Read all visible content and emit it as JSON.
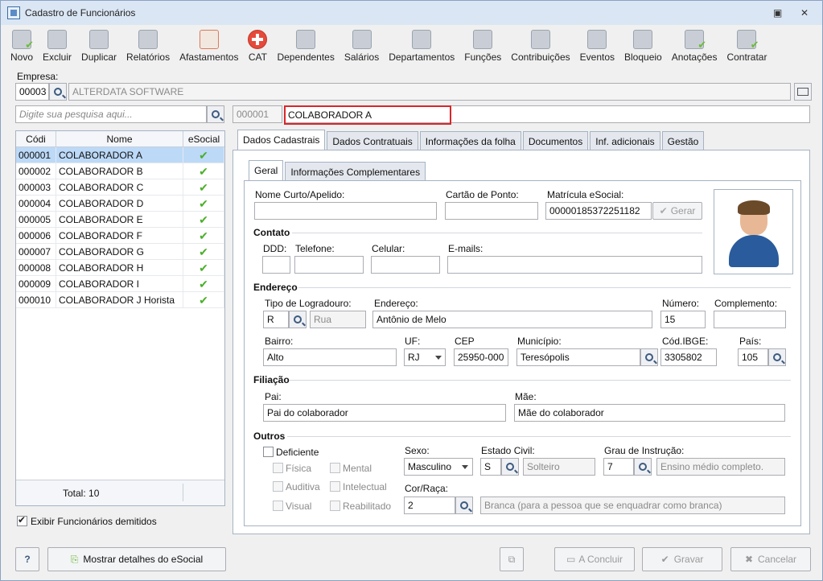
{
  "window": {
    "title": "Cadastro de Funcionários"
  },
  "toolbar": [
    {
      "label": "Novo",
      "icon": "new-icon"
    },
    {
      "label": "Excluir",
      "icon": "trash-icon"
    },
    {
      "label": "Duplicar",
      "icon": "duplicate-icon"
    },
    {
      "label": "Relatórios",
      "icon": "report-icon"
    },
    {
      "label": "Afastamentos",
      "icon": "house-icon"
    },
    {
      "label": "CAT",
      "icon": "cross-icon"
    },
    {
      "label": "Dependentes",
      "icon": "dependents-icon"
    },
    {
      "label": "Salários",
      "icon": "money-icon"
    },
    {
      "label": "Departamentos",
      "icon": "department-icon"
    },
    {
      "label": "Funções",
      "icon": "function-icon"
    },
    {
      "label": "Contribuições",
      "icon": "contribution-icon"
    },
    {
      "label": "Eventos",
      "icon": "events-icon"
    },
    {
      "label": "Bloqueio",
      "icon": "lock-icon"
    },
    {
      "label": "Anotações",
      "icon": "notes-icon"
    },
    {
      "label": "Contratar",
      "icon": "hire-icon"
    }
  ],
  "empresa": {
    "label": "Empresa:",
    "code": "00003",
    "name": "ALTERDATA SOFTWARE"
  },
  "search": {
    "placeholder": "Digite sua pesquisa aqui..."
  },
  "selected": {
    "code": "000001",
    "name": "COLABORADOR A"
  },
  "grid": {
    "headers": [
      "Códi",
      "Nome",
      "eSocial"
    ],
    "rows": [
      {
        "code": "000001",
        "name": "COLABORADOR A"
      },
      {
        "code": "000002",
        "name": "COLABORADOR B"
      },
      {
        "code": "000003",
        "name": "COLABORADOR C"
      },
      {
        "code": "000004",
        "name": "COLABORADOR D"
      },
      {
        "code": "000005",
        "name": "COLABORADOR E"
      },
      {
        "code": "000006",
        "name": "COLABORADOR F"
      },
      {
        "code": "000007",
        "name": "COLABORADOR G"
      },
      {
        "code": "000008",
        "name": "COLABORADOR H"
      },
      {
        "code": "000009",
        "name": "COLABORADOR I"
      },
      {
        "code": "000010",
        "name": "COLABORADOR J Horista"
      }
    ],
    "total": "Total: 10"
  },
  "exibir_demitidos": "Exibir Funcionários demitidos",
  "tabs": [
    "Dados Cadastrais",
    "Dados Contratuais",
    "Informações da folha",
    "Documentos",
    "Inf. adicionais",
    "Gestão"
  ],
  "subtabs": [
    "Geral",
    "Informações Complementares"
  ],
  "form": {
    "nome_curto": "Nome Curto/Apelido:",
    "cartao_ponto": "Cartão de Ponto:",
    "matricula_label": "Matrícula eSocial:",
    "matricula_value": "00000185372251182",
    "gerar": "Gerar",
    "contato": "Contato",
    "ddd": "DDD:",
    "telefone": "Telefone:",
    "celular": "Celular:",
    "emails": "E-mails:",
    "endereco_section": "Endereço",
    "tipo_logradouro": "Tipo de Logradouro:",
    "tipo_code": "R",
    "tipo_name": "Rua",
    "endereco_label": "Endereço:",
    "endereco_value": "Antônio de Melo",
    "numero_label": "Número:",
    "numero_value": "15",
    "complemento": "Complemento:",
    "bairro_label": "Bairro:",
    "bairro_value": "Alto",
    "uf_label": "UF:",
    "uf_value": "RJ",
    "cep_label": "CEP",
    "cep_value": "25950-000",
    "municipio_label": "Município:",
    "municipio_value": "Teresópolis",
    "ibge_label": "Cód.IBGE:",
    "ibge_value": "3305802",
    "pais_label": "País:",
    "pais_value": "105",
    "filiacao": "Filiação",
    "pai_label": "Pai:",
    "pai_value": "Pai do colaborador",
    "mae_label": "Mãe:",
    "mae_value": "Mãe do colaborador",
    "outros": "Outros",
    "deficiente": "Deficiente",
    "fisica": "Física",
    "mental": "Mental",
    "auditiva": "Auditiva",
    "intelectual": "Intelectual",
    "visual": "Visual",
    "reabilitado": "Reabilitado",
    "sexo_label": "Sexo:",
    "sexo_value": "Masculino",
    "estado_civil_label": "Estado Civil:",
    "estado_civil_code": "S",
    "estado_civil_name": "Solteiro",
    "grau_label": "Grau de Instrução:",
    "grau_code": "7",
    "grau_name": "Ensino médio completo.",
    "cor_label": "Cor/Raça:",
    "cor_code": "2",
    "cor_name": "Branca (para a pessoa que se enquadrar como branca)"
  },
  "bottom": {
    "help": "?",
    "esocial_details": "Mostrar detalhes do eSocial",
    "concluir": "A Concluir",
    "gravar": "Gravar",
    "cancelar": "Cancelar"
  }
}
